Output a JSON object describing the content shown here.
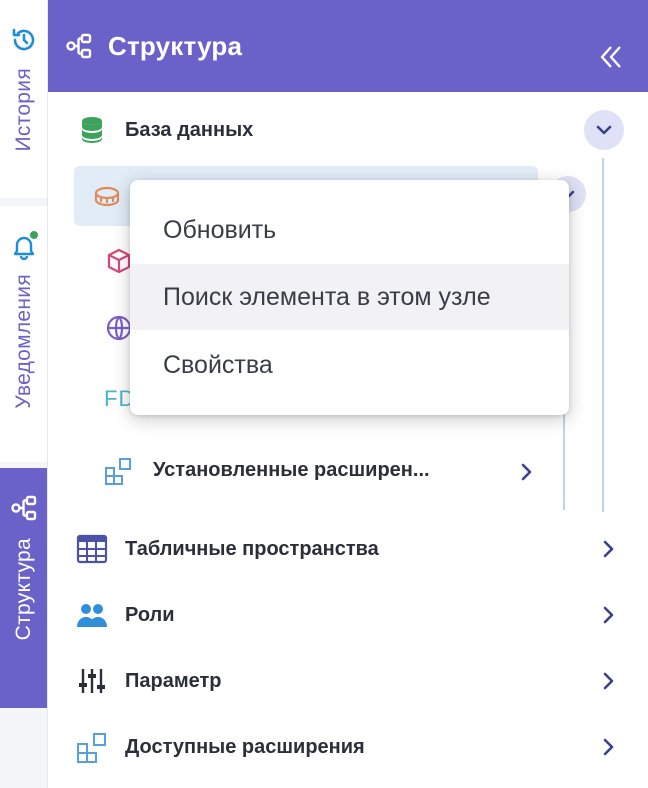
{
  "rail": {
    "history_label": "История",
    "notifications_label": "Уведомления",
    "structure_label": "Структура",
    "history_icon": "history-clock-icon",
    "notifications_icon": "bell-icon",
    "structure_icon": "structure-tree-icon"
  },
  "header": {
    "title": "Структура",
    "icon": "structure-tree-icon",
    "collapse_icon": "double-chevron-left-icon"
  },
  "tree": {
    "database": {
      "label": "База данных",
      "icon": "database-icon",
      "expanded": true
    },
    "children": {
      "installed_extensions": {
        "label": "Установленные расширен...",
        "icon": "extensions-icon"
      },
      "fd_text": "FD"
    },
    "items": [
      {
        "label": "Табличные пространства",
        "icon": "table-grid-icon"
      },
      {
        "label": "Роли",
        "icon": "users-icon"
      },
      {
        "label": "Параметр",
        "icon": "sliders-icon"
      },
      {
        "label": "Доступные расширения",
        "icon": "extensions-icon"
      }
    ]
  },
  "context_menu": {
    "items": [
      {
        "label": "Обновить"
      },
      {
        "label": "Поиск элемента в этом узле",
        "hovered": true
      },
      {
        "label": "Свойства"
      }
    ]
  },
  "colors": {
    "accent": "#6a62c8",
    "database_icon": "#3ea35a",
    "selection": "#e2ecf7",
    "notification_dot": "#3ea35a"
  }
}
